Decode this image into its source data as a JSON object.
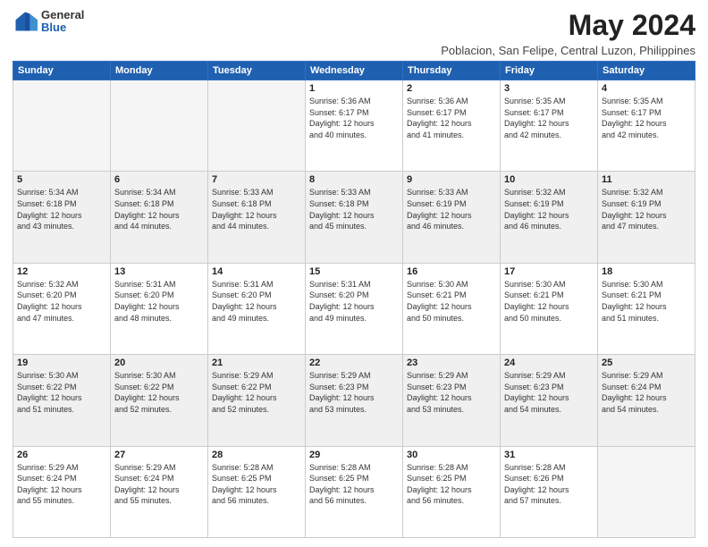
{
  "logo": {
    "general": "General",
    "blue": "Blue"
  },
  "header": {
    "month": "May 2024",
    "location": "Poblacion, San Felipe, Central Luzon, Philippines"
  },
  "weekdays": [
    "Sunday",
    "Monday",
    "Tuesday",
    "Wednesday",
    "Thursday",
    "Friday",
    "Saturday"
  ],
  "weeks": [
    [
      {
        "day": "",
        "info": ""
      },
      {
        "day": "",
        "info": ""
      },
      {
        "day": "",
        "info": ""
      },
      {
        "day": "1",
        "info": "Sunrise: 5:36 AM\nSunset: 6:17 PM\nDaylight: 12 hours\nand 40 minutes."
      },
      {
        "day": "2",
        "info": "Sunrise: 5:36 AM\nSunset: 6:17 PM\nDaylight: 12 hours\nand 41 minutes."
      },
      {
        "day": "3",
        "info": "Sunrise: 5:35 AM\nSunset: 6:17 PM\nDaylight: 12 hours\nand 42 minutes."
      },
      {
        "day": "4",
        "info": "Sunrise: 5:35 AM\nSunset: 6:17 PM\nDaylight: 12 hours\nand 42 minutes."
      }
    ],
    [
      {
        "day": "5",
        "info": "Sunrise: 5:34 AM\nSunset: 6:18 PM\nDaylight: 12 hours\nand 43 minutes."
      },
      {
        "day": "6",
        "info": "Sunrise: 5:34 AM\nSunset: 6:18 PM\nDaylight: 12 hours\nand 44 minutes."
      },
      {
        "day": "7",
        "info": "Sunrise: 5:33 AM\nSunset: 6:18 PM\nDaylight: 12 hours\nand 44 minutes."
      },
      {
        "day": "8",
        "info": "Sunrise: 5:33 AM\nSunset: 6:18 PM\nDaylight: 12 hours\nand 45 minutes."
      },
      {
        "day": "9",
        "info": "Sunrise: 5:33 AM\nSunset: 6:19 PM\nDaylight: 12 hours\nand 46 minutes."
      },
      {
        "day": "10",
        "info": "Sunrise: 5:32 AM\nSunset: 6:19 PM\nDaylight: 12 hours\nand 46 minutes."
      },
      {
        "day": "11",
        "info": "Sunrise: 5:32 AM\nSunset: 6:19 PM\nDaylight: 12 hours\nand 47 minutes."
      }
    ],
    [
      {
        "day": "12",
        "info": "Sunrise: 5:32 AM\nSunset: 6:20 PM\nDaylight: 12 hours\nand 47 minutes."
      },
      {
        "day": "13",
        "info": "Sunrise: 5:31 AM\nSunset: 6:20 PM\nDaylight: 12 hours\nand 48 minutes."
      },
      {
        "day": "14",
        "info": "Sunrise: 5:31 AM\nSunset: 6:20 PM\nDaylight: 12 hours\nand 49 minutes."
      },
      {
        "day": "15",
        "info": "Sunrise: 5:31 AM\nSunset: 6:20 PM\nDaylight: 12 hours\nand 49 minutes."
      },
      {
        "day": "16",
        "info": "Sunrise: 5:30 AM\nSunset: 6:21 PM\nDaylight: 12 hours\nand 50 minutes."
      },
      {
        "day": "17",
        "info": "Sunrise: 5:30 AM\nSunset: 6:21 PM\nDaylight: 12 hours\nand 50 minutes."
      },
      {
        "day": "18",
        "info": "Sunrise: 5:30 AM\nSunset: 6:21 PM\nDaylight: 12 hours\nand 51 minutes."
      }
    ],
    [
      {
        "day": "19",
        "info": "Sunrise: 5:30 AM\nSunset: 6:22 PM\nDaylight: 12 hours\nand 51 minutes."
      },
      {
        "day": "20",
        "info": "Sunrise: 5:30 AM\nSunset: 6:22 PM\nDaylight: 12 hours\nand 52 minutes."
      },
      {
        "day": "21",
        "info": "Sunrise: 5:29 AM\nSunset: 6:22 PM\nDaylight: 12 hours\nand 52 minutes."
      },
      {
        "day": "22",
        "info": "Sunrise: 5:29 AM\nSunset: 6:23 PM\nDaylight: 12 hours\nand 53 minutes."
      },
      {
        "day": "23",
        "info": "Sunrise: 5:29 AM\nSunset: 6:23 PM\nDaylight: 12 hours\nand 53 minutes."
      },
      {
        "day": "24",
        "info": "Sunrise: 5:29 AM\nSunset: 6:23 PM\nDaylight: 12 hours\nand 54 minutes."
      },
      {
        "day": "25",
        "info": "Sunrise: 5:29 AM\nSunset: 6:24 PM\nDaylight: 12 hours\nand 54 minutes."
      }
    ],
    [
      {
        "day": "26",
        "info": "Sunrise: 5:29 AM\nSunset: 6:24 PM\nDaylight: 12 hours\nand 55 minutes."
      },
      {
        "day": "27",
        "info": "Sunrise: 5:29 AM\nSunset: 6:24 PM\nDaylight: 12 hours\nand 55 minutes."
      },
      {
        "day": "28",
        "info": "Sunrise: 5:28 AM\nSunset: 6:25 PM\nDaylight: 12 hours\nand 56 minutes."
      },
      {
        "day": "29",
        "info": "Sunrise: 5:28 AM\nSunset: 6:25 PM\nDaylight: 12 hours\nand 56 minutes."
      },
      {
        "day": "30",
        "info": "Sunrise: 5:28 AM\nSunset: 6:25 PM\nDaylight: 12 hours\nand 56 minutes."
      },
      {
        "day": "31",
        "info": "Sunrise: 5:28 AM\nSunset: 6:26 PM\nDaylight: 12 hours\nand 57 minutes."
      },
      {
        "day": "",
        "info": ""
      }
    ]
  ]
}
